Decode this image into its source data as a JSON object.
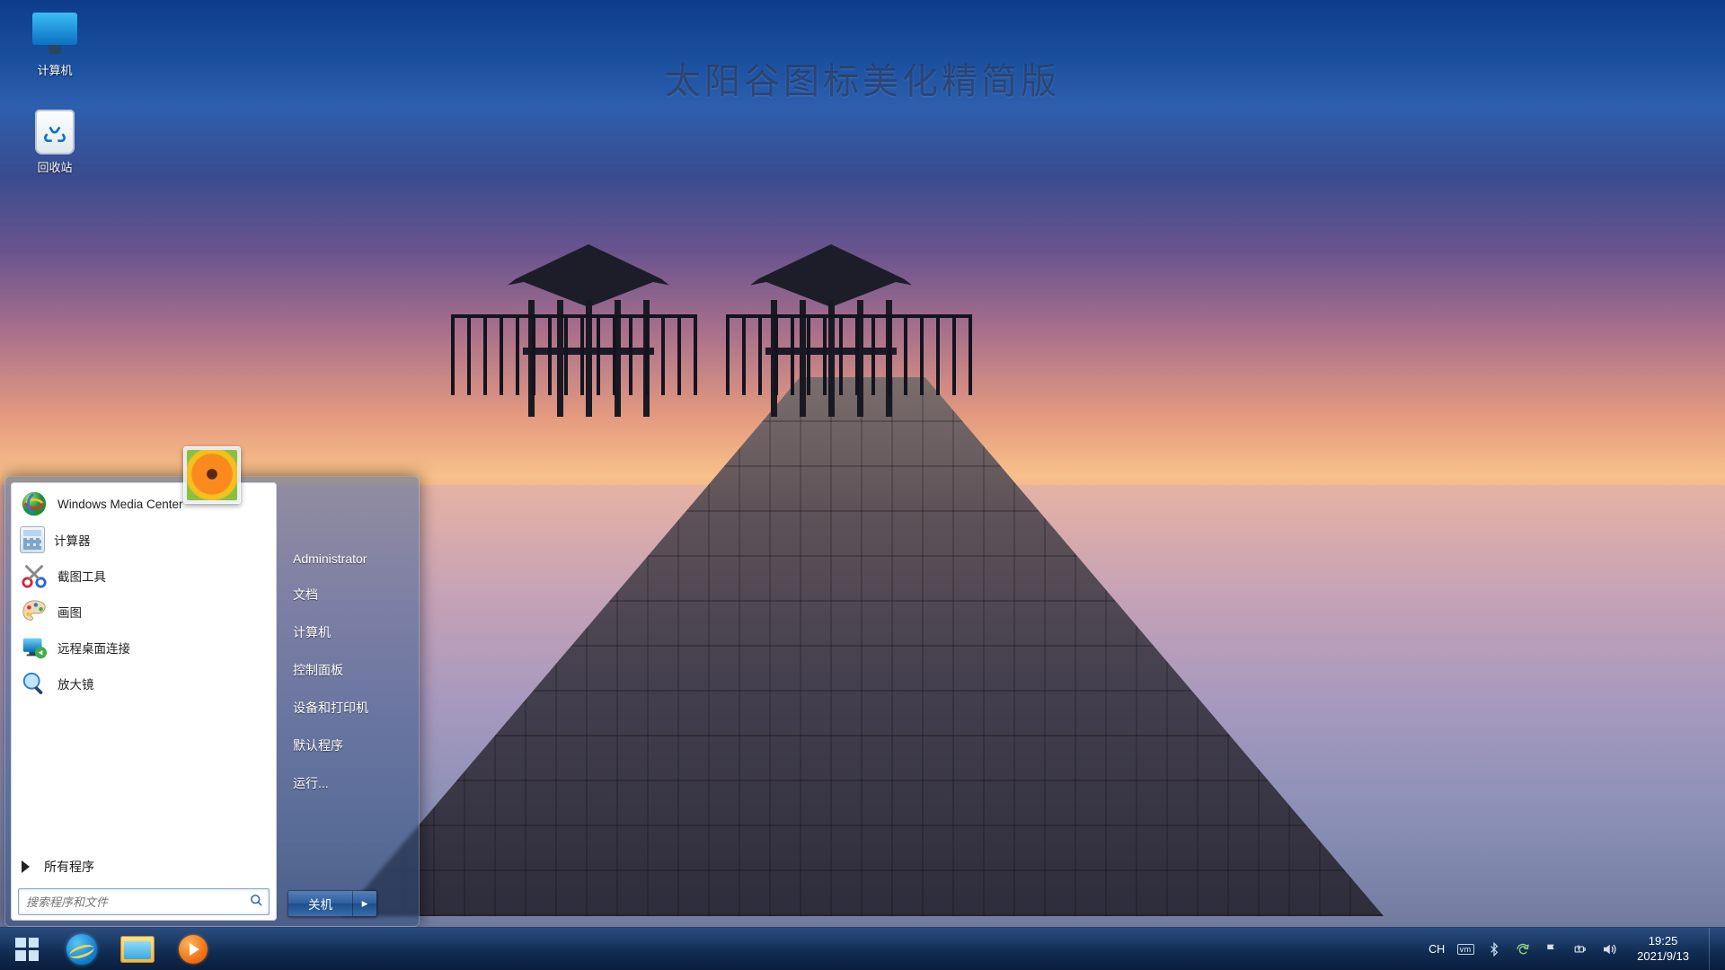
{
  "watermark": "太阳谷图标美化精简版",
  "desktop_icons": {
    "computer": "计算机",
    "recycle": "回收站"
  },
  "start_menu": {
    "programs": {
      "wmc": "Windows Media Center",
      "calc": "计算器",
      "snip": "截图工具",
      "paint": "画图",
      "rdp": "远程桌面连接",
      "mag": "放大镜"
    },
    "all_programs": "所有程序",
    "search_placeholder": "搜索程序和文件",
    "user": "Administrator",
    "links": {
      "documents": "文档",
      "computer": "计算机",
      "control_panel": "控制面板",
      "devices": "设备和打印机",
      "defaults": "默认程序",
      "run": "运行..."
    },
    "shutdown": "关机"
  },
  "taskbar": {
    "tray": {
      "ime": "CH",
      "vm": "vm",
      "time": "19:25",
      "date": "2021/9/13"
    }
  }
}
